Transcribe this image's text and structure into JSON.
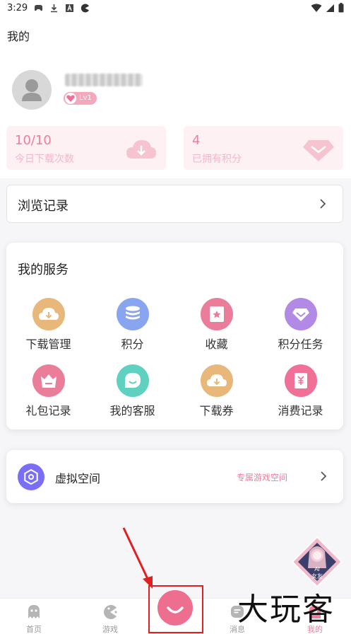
{
  "status_bar": {
    "time": "3:29"
  },
  "header": {
    "title": "我的"
  },
  "profile": {
    "level": "Lv1"
  },
  "stats": [
    {
      "value": "10/10",
      "label": "今日下载次数",
      "icon": "cloud-download-icon"
    },
    {
      "value": "4",
      "label": "已拥有积分",
      "icon": "diamond-icon"
    }
  ],
  "history": {
    "label": "浏览记录"
  },
  "services": {
    "title": "我的服务",
    "items": [
      {
        "label": "下载管理",
        "icon": "download-manage-icon",
        "color": "#e8b87a"
      },
      {
        "label": "积分",
        "icon": "coins-icon",
        "color": "#8aa5f0"
      },
      {
        "label": "收藏",
        "icon": "favorite-icon",
        "color": "#ea7e9a"
      },
      {
        "label": "积分任务",
        "icon": "task-diamond-icon",
        "color": "#b28ae6"
      },
      {
        "label": "礼包记录",
        "icon": "gift-basket-icon",
        "color": "#ea7e9a"
      },
      {
        "label": "我的客服",
        "icon": "customer-service-icon",
        "color": "#5ed1c0"
      },
      {
        "label": "下载券",
        "icon": "download-coupon-icon",
        "color": "#e8b87a"
      },
      {
        "label": "消费记录",
        "icon": "spending-record-icon",
        "color": "#f07098"
      }
    ]
  },
  "virtual_space": {
    "label": "虚拟空间",
    "tag": "专属游戏空间"
  },
  "mascot": {
    "line1": "AI",
    "line2": "女友"
  },
  "tabs": [
    {
      "label": "首页",
      "icon": "ghost-icon"
    },
    {
      "label": "游戏",
      "icon": "gamepad-icon"
    },
    {
      "label": "",
      "icon": "smile-icon"
    },
    {
      "label": "消息",
      "icon": "message-icon"
    },
    {
      "label": "我的",
      "icon": "profile-icon"
    }
  ],
  "watermark": "大玩客",
  "colors": {
    "accent": "#ee7e9c",
    "highlight": "#e02020"
  }
}
